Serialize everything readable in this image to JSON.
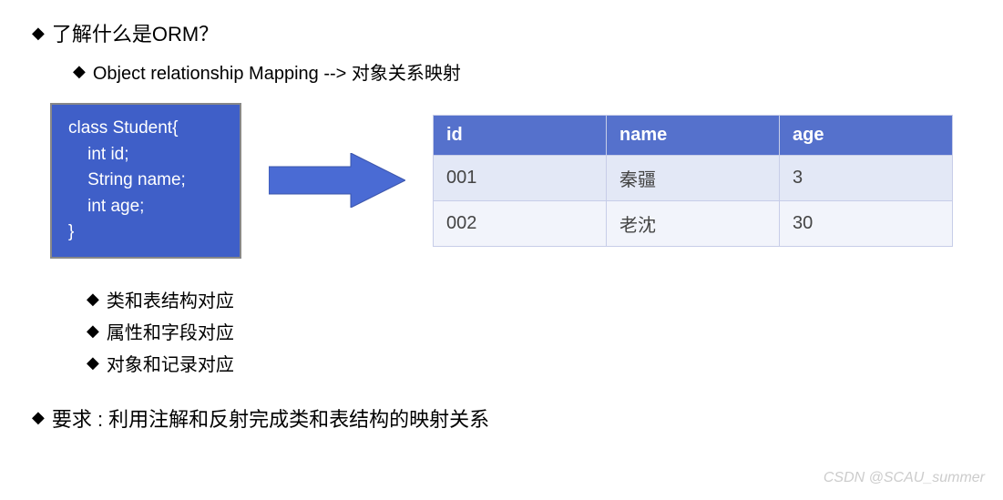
{
  "top_bullet": "了解什么是ORM？",
  "sub_bullet": "Object relationship Mapping --> 对象关系映射",
  "code_box": {
    "line1": "class Student{",
    "line2_indent": "    int id;",
    "line3_indent": "    String name;",
    "line4_indent": "    int age;",
    "line5": "}"
  },
  "table": {
    "headers": [
      "id",
      "name",
      "age"
    ],
    "rows": [
      [
        "001",
        "秦疆",
        "3"
      ],
      [
        "002",
        "老沈",
        "30"
      ]
    ]
  },
  "mapping_bullets": [
    "类和表结构对应",
    "属性和字段对应",
    "对象和记录对应"
  ],
  "final_bullet": "要求 : 利用注解和反射完成类和表结构的映射关系",
  "watermark": "CSDN @SCAU_summer",
  "colors": {
    "accent": "#3f5fc8",
    "table_header": "#5571cc"
  }
}
